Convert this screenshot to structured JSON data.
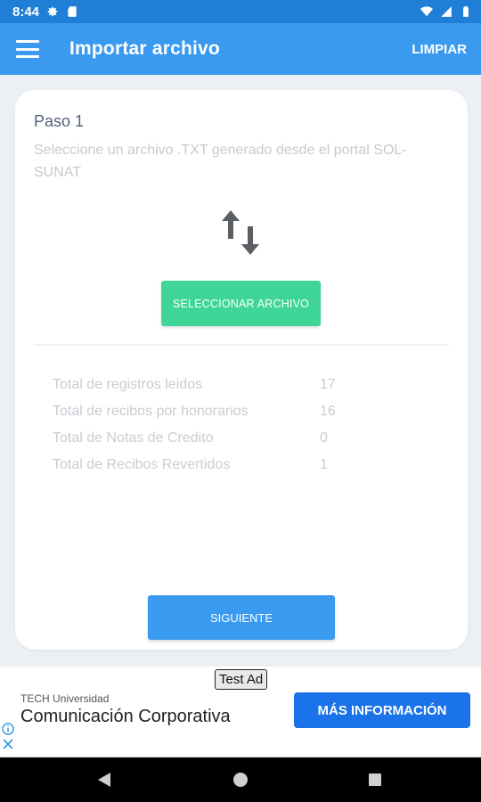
{
  "status_bar": {
    "time": "8:44",
    "icons": [
      "gear-icon",
      "sd-card-icon",
      "wifi-icon",
      "signal-icon",
      "battery-icon"
    ]
  },
  "app_bar": {
    "menu_icon": "hamburger-menu-icon",
    "title": "Importar archivo",
    "action_label": "LIMPIAR"
  },
  "card": {
    "step_title": "Paso 1",
    "step_description": "Seleccione un archivo .TXT generado desde el portal SOL-SUNAT",
    "icon": "swap-vertical-icon",
    "select_button_label": "SELECCIONAR ARCHIVO",
    "stats": [
      {
        "label": "Total de registros leidos",
        "value": "17"
      },
      {
        "label": "Total de recibos por honorarios",
        "value": "16"
      },
      {
        "label": "Total de Notas de Credito",
        "value": "0"
      },
      {
        "label": "Total de Recibos Revertidos",
        "value": "1"
      }
    ],
    "next_button_label": "SIGUIENTE"
  },
  "ad": {
    "badge": "Test Ad",
    "advertiser": "TECH Universidad",
    "headline": "Comunicación Corporativa",
    "cta_label": "MÁS INFORMACIÓN",
    "icons": [
      "info-icon",
      "close-icon"
    ]
  },
  "nav_bar": {
    "icons": [
      "back-icon",
      "home-icon",
      "recents-icon"
    ]
  },
  "colors": {
    "status_bar": "#1f7fd6",
    "app_bar": "#3a9af0",
    "select_button": "#3fd597",
    "next_button": "#3a9af0",
    "ad_cta": "#1a73e8",
    "background": "#eceff3"
  }
}
